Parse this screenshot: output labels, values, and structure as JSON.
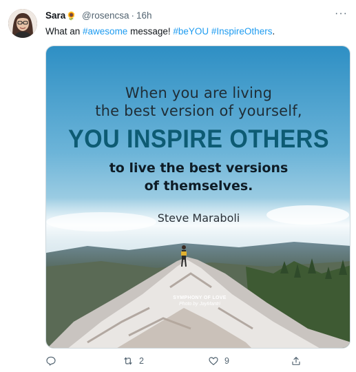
{
  "tweet": {
    "author_name": "Sara",
    "author_emoji": "🌻",
    "handle": "@rosencsa",
    "separator": "·",
    "time": "16h",
    "more_label": "···",
    "text_prefix": "What an ",
    "hashtag_1": "#awesome",
    "text_middle": " message! ",
    "hashtag_2": "#beYOU",
    "text_space": " ",
    "hashtag_3": "#InspireOthers",
    "text_suffix": "."
  },
  "image": {
    "line1": "When you are living",
    "line2": "the best version of yourself,",
    "line3": "YOU INSPIRE OTHERS",
    "line4": "to live the best versions",
    "line5": "of themselves.",
    "author": "Steve Maraboli",
    "credit1": "SYMPHONY OF LOVE",
    "credit2": "Photo by JayMantri"
  },
  "actions": {
    "reply_icon": "reply-icon",
    "retweet_icon": "retweet-icon",
    "retweet_count": "2",
    "like_icon": "heart-icon",
    "like_count": "9",
    "share_icon": "share-icon"
  },
  "colors": {
    "link": "#1d9bf0",
    "muted": "#536471",
    "headline": "#0d5b73"
  }
}
